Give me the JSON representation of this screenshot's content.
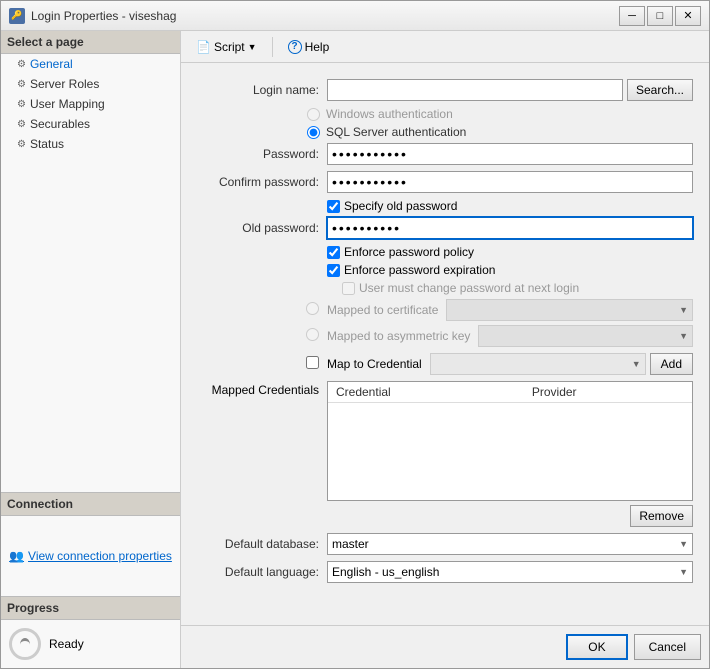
{
  "window": {
    "title": "Login Properties - viseshag",
    "icon": "🔑",
    "min_btn": "─",
    "max_btn": "□",
    "close_btn": "✕"
  },
  "toolbar": {
    "script_label": "Script",
    "help_label": "Help"
  },
  "sidebar": {
    "select_page_label": "Select a page",
    "items": [
      {
        "label": "General",
        "icon": "⚙"
      },
      {
        "label": "Server Roles",
        "icon": "⚙"
      },
      {
        "label": "User Mapping",
        "icon": "⚙"
      },
      {
        "label": "Securables",
        "icon": "⚙"
      },
      {
        "label": "Status",
        "icon": "⚙"
      }
    ],
    "connection_label": "Connection",
    "view_connection_label": "View connection properties",
    "progress_label": "Progress",
    "ready_label": "Ready"
  },
  "form": {
    "login_name_label": "Login name:",
    "login_name_value": "",
    "search_btn": "Search...",
    "windows_auth_label": "Windows authentication",
    "sql_auth_label": "SQL Server authentication",
    "password_label": "Password:",
    "password_value": "●●●●●●●●●●●●●",
    "confirm_password_label": "Confirm password:",
    "confirm_password_value": "●●●●●●●●●●●●●",
    "specify_old_password_label": "Specify old password",
    "old_password_label": "Old password:",
    "old_password_value": "●●●●●●●●●●",
    "enforce_policy_label": "Enforce password policy",
    "enforce_expiration_label": "Enforce password expiration",
    "user_must_change_label": "User must change password at next login",
    "mapped_certificate_label": "Mapped to certificate",
    "mapped_asymmetric_label": "Mapped to asymmetric key",
    "map_credential_label": "Map to Credential",
    "add_btn": "Add",
    "mapped_credentials_label": "Mapped Credentials",
    "credential_col": "Credential",
    "provider_col": "Provider",
    "remove_btn": "Remove",
    "default_database_label": "Default database:",
    "default_database_value": "master",
    "default_language_label": "Default language:",
    "default_language_value": "English - us_english",
    "ok_btn": "OK",
    "cancel_btn": "Cancel"
  }
}
